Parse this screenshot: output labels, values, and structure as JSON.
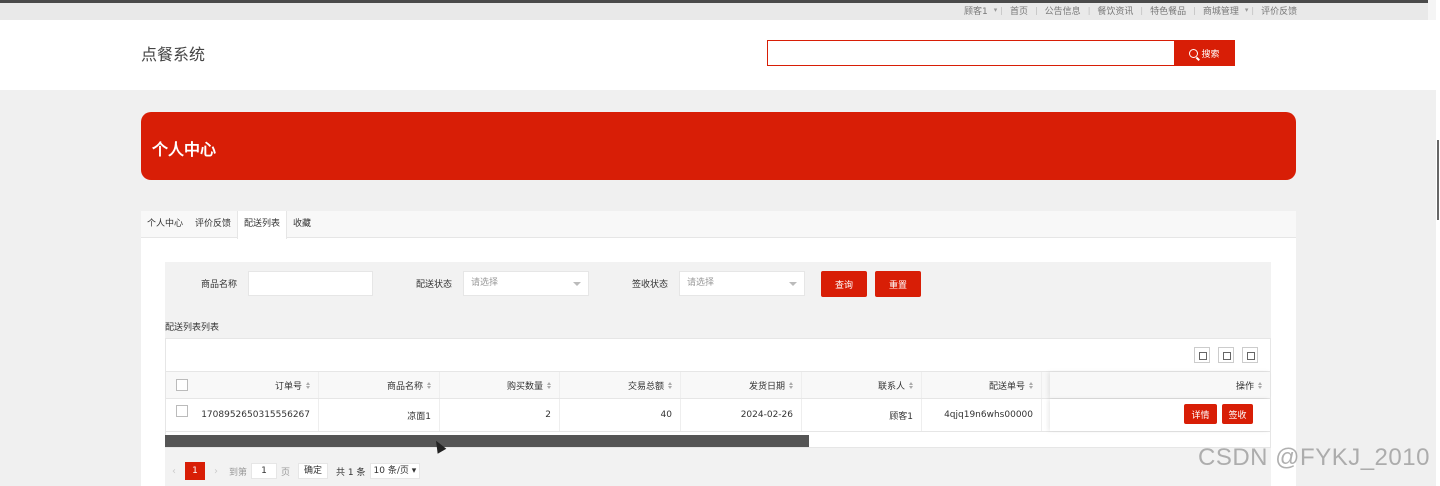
{
  "topnav": {
    "items": [
      "顾客1",
      "首页",
      "公告信息",
      "餐饮资讯",
      "特色餐品",
      "商城管理",
      "评价反馈"
    ]
  },
  "header": {
    "logo": "点餐系统",
    "search_value": "",
    "search_button": "搜索"
  },
  "banner": {
    "title": "个人中心"
  },
  "tabs": [
    "个人中心",
    "评价反馈",
    "配送列表",
    "收藏"
  ],
  "active_tab": "配送列表",
  "filters": {
    "product_name_label": "商品名称",
    "product_name_value": "",
    "delivery_status_label": "配送状态",
    "delivery_status_value": "请选择",
    "sign_status_label": "签收状态",
    "sign_status_value": "请选择",
    "query_button": "查询",
    "reset_button": "重置"
  },
  "list_title": "配送列表列表",
  "table": {
    "columns": [
      "订单号",
      "商品名称",
      "购买数量",
      "交易总额",
      "发货日期",
      "联系人",
      "配送单号",
      "操作"
    ],
    "rows": [
      {
        "order_no": "1708952650315556267",
        "product_name": "凉面1",
        "quantity": "2",
        "total": "40",
        "ship_date": "2024-02-26",
        "contact": "顾客1",
        "delivery_no": "4qjq19n6whs00000",
        "actions": [
          "详情",
          "签收"
        ]
      }
    ]
  },
  "pager": {
    "current_page": "1",
    "goto_label": "到第",
    "goto_value": "1",
    "page_unit": "页",
    "confirm": "确定",
    "total": "共 1 条",
    "per_page": "10 条/页"
  },
  "watermark": "CSDN @FYKJ_2010",
  "colors": {
    "accent": "#d81e06"
  }
}
